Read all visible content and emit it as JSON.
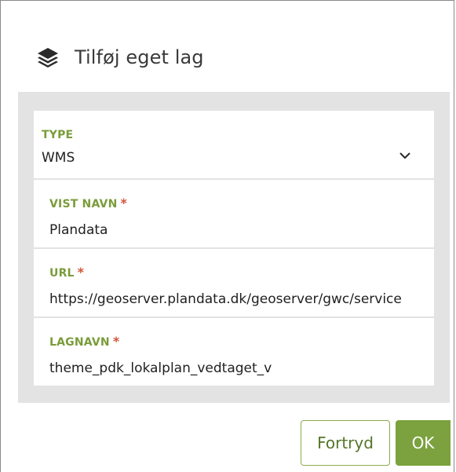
{
  "dialog": {
    "title": "Tilføj eget lag",
    "icon": "layers-icon"
  },
  "form": {
    "type": {
      "label": "TYPE",
      "value": "WMS",
      "icon": "chevron-down-icon"
    },
    "display_name": {
      "label": "VIST NAVN",
      "required_mark": "*",
      "value": "Plandata"
    },
    "url": {
      "label": "URL",
      "required_mark": "*",
      "value": "https://geoserver.plandata.dk/geoserver/gwc/service"
    },
    "layer_name": {
      "label": "LAGNAVN",
      "required_mark": "*",
      "value": "theme_pdk_lokalplan_vedtaget_v"
    }
  },
  "actions": {
    "cancel_label": "Fortryd",
    "ok_label": "OK"
  },
  "colors": {
    "accent_green": "#7ba23e",
    "label_green": "#7a9c3a",
    "required_red": "#d2553a",
    "panel_gray": "#e3e3e3"
  }
}
